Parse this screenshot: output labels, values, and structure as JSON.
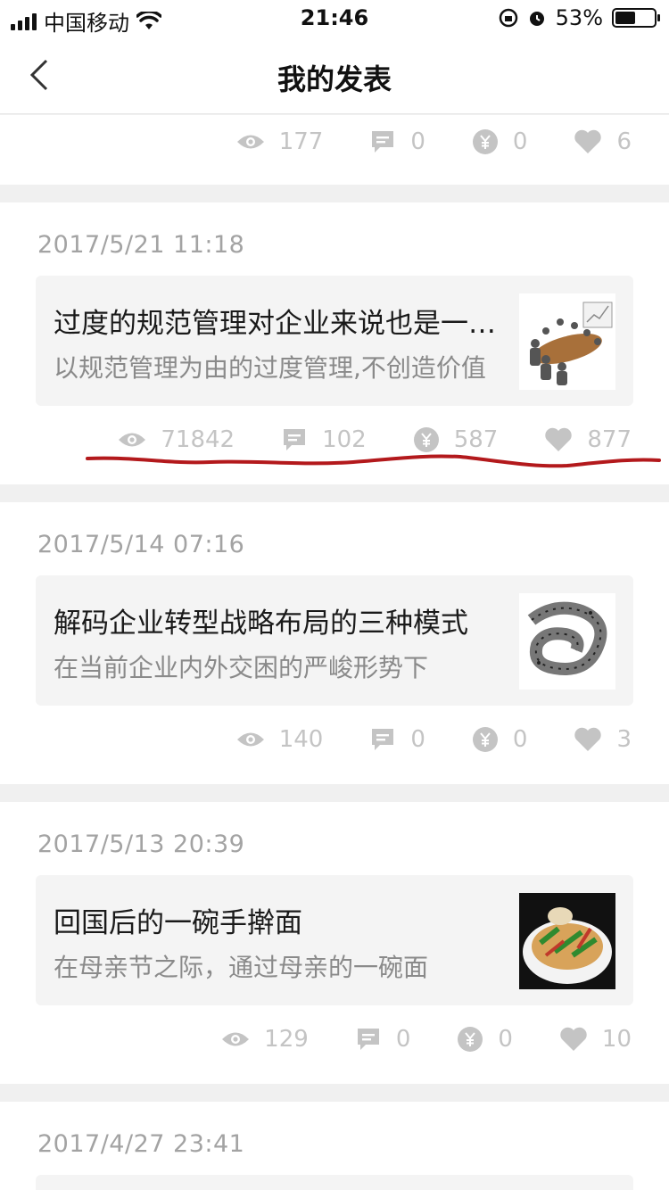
{
  "status_bar": {
    "carrier": "中国移动",
    "time": "21:46",
    "battery": "53%",
    "battery_level": 0.53
  },
  "nav": {
    "title": "我的发表"
  },
  "top_partial": {
    "views": "177",
    "comments": "0",
    "rewards": "0",
    "likes": "6"
  },
  "posts": [
    {
      "date": "2017/5/21  11:18",
      "title": "过度的规范管理对企业来说也是一种伤害",
      "summary": "以规范管理为由的过度管理,不创造价值",
      "views": "71842",
      "comments": "102",
      "rewards": "587",
      "likes": "877",
      "thumb": "meeting-image"
    },
    {
      "date": "2017/5/14  07:16",
      "title": "解码企业转型战略布局的三种模式",
      "summary": "在当前企业内外交困的严峻形势下",
      "views": "140",
      "comments": "0",
      "rewards": "0",
      "likes": "3",
      "thumb": "maze-image"
    },
    {
      "date": "2017/5/13  20:39",
      "title": "回国后的一碗手擀面",
      "summary": "在母亲节之际，通过母亲的一碗面",
      "views": "129",
      "comments": "0",
      "rewards": "0",
      "likes": "10",
      "thumb": "noodle-image"
    },
    {
      "date": "2017/4/27  23:41"
    }
  ],
  "icons": {
    "views": "eye-icon",
    "comments": "comment-icon",
    "rewards": "yuan-coin-icon",
    "likes": "heart-icon",
    "back": "chevron-left-icon"
  },
  "colors": {
    "stat_gray": "#c4c4c4",
    "annotation_red": "#b3191c"
  }
}
